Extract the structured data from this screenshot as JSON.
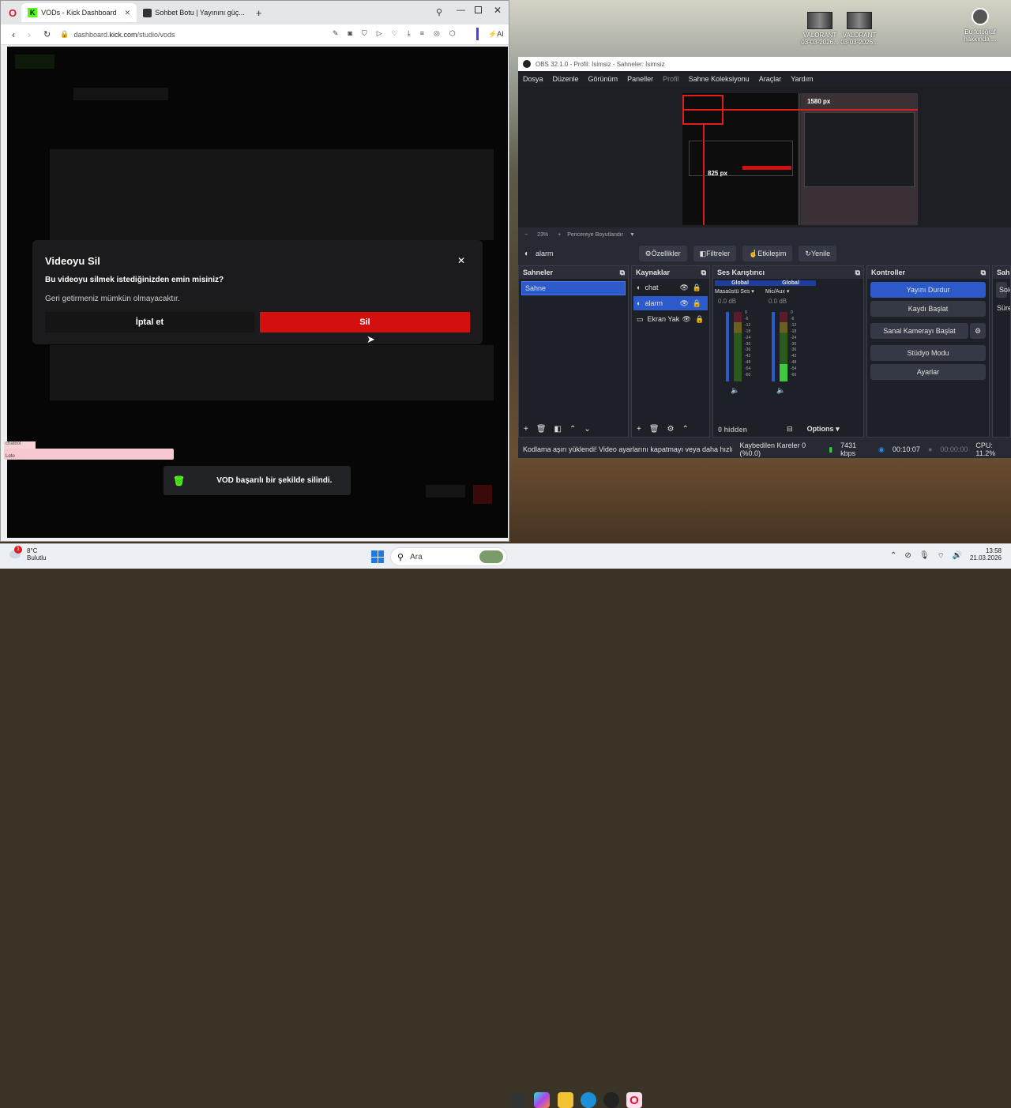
{
  "desktop": {
    "icons": [
      {
        "label": "VALORANT",
        "sub": "03-03-2026...",
        "icon": "video-thumbnail-icon"
      },
      {
        "label": "VALORANT",
        "sub": "03-03-2026...",
        "icon": "video-thumbnail-icon"
      },
      {
        "label": "Bu fotoğraf hakkında ...",
        "icon": "camera-icon"
      }
    ]
  },
  "browser": {
    "tabs": [
      {
        "label": "VODs - Kick Dashboard",
        "active": true
      },
      {
        "label": "Sohbet Botu | Yayınını güç..."
      }
    ],
    "url_domain": "dashboard.",
    "url_host": "kick.com",
    "url_path": "/studio/vods",
    "ai_label": "AI",
    "modal": {
      "title": "Videoyu Sil",
      "question": "Bu videoyu silmek istediğinizden emin misiniz?",
      "note": "Geri getirmeniz mümkün olmayacaktır.",
      "cancel": "İptal et",
      "delete": "Sil"
    },
    "toast": "VOD başarılı bir şekilde silindi.",
    "alert_tag": "chatbot",
    "alert_text": "Loto"
  },
  "obs": {
    "title": "OBS 32.1.0 - Profil: İsimsiz - Sahneler: İsimsiz",
    "menu": [
      "Dosya",
      "Düzenle",
      "Görünüm",
      "Paneller",
      "Profil",
      "Sahne Koleksiyonu",
      "Araçlar",
      "Yardım"
    ],
    "preview_px_top": "1580 px",
    "preview_px_left": "825 px",
    "zoom": "23%",
    "fit_label": "Pencereye Boyutlandır",
    "selected_source": "alarm",
    "source_buttons": [
      "Özellikler",
      "Filtreler",
      "Etkileşim",
      "Yenile"
    ],
    "scenes": {
      "title": "Sahneler",
      "items": [
        "Sahne"
      ]
    },
    "sources": {
      "title": "Kaynaklar",
      "items": [
        "chat",
        "alarm",
        "Ekran Yak"
      ]
    },
    "mixer": {
      "title": "Ses Karıştırıcı",
      "channels": [
        {
          "global": "Global",
          "name": "Masaüstü Ses",
          "db": "0.0 dB"
        },
        {
          "global": "Global",
          "name": "Mic/Aux",
          "db": "0.0 dB"
        }
      ],
      "hidden": "0 hidden",
      "options": "Options",
      "scale": [
        "0",
        "-6",
        "-12",
        "-18",
        "-24",
        "-30",
        "-36",
        "-42",
        "-48",
        "-54",
        "-60"
      ]
    },
    "controls": {
      "title": "Kontroller",
      "buttons": [
        "Yayını Durdur",
        "Kaydı Başlat",
        "Sanal Kamerayı Başlat",
        "Stüdyo Modu",
        "Ayarlar"
      ]
    },
    "transitions": {
      "title": "Sahn",
      "items": [
        "Solo",
        "Süre"
      ]
    },
    "status": {
      "warning": "Kodlama aşırı yüklendi! Video ayarlarını kapatmayı veya daha hızlı bir",
      "dropped": "Kaybedilen Kareler 0 (%0.0)",
      "bitrate": "7431 kbps",
      "stream_time": "00:10:07",
      "rec_time": "00:00:00",
      "cpu": "CPU: 11.2%"
    }
  },
  "taskbar": {
    "weather_temp": "8°C",
    "weather_desc": "Bulutlu",
    "weather_badge": "1",
    "search": "Ara",
    "time": "13:58",
    "date": "21.03.2026"
  }
}
